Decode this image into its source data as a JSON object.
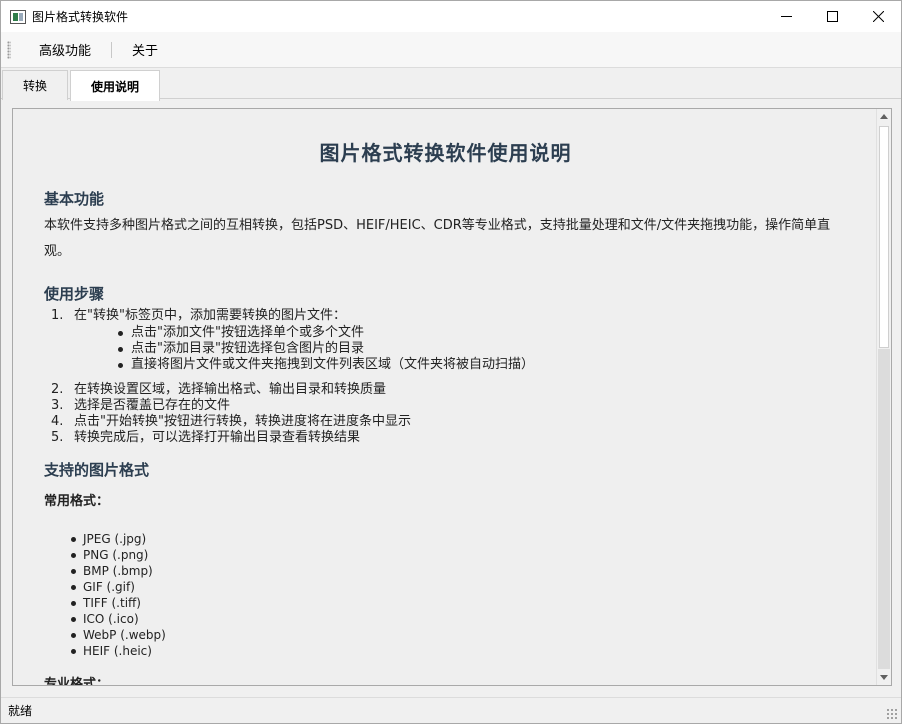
{
  "window": {
    "title": "图片格式转换软件",
    "icon": "image-converter-icon"
  },
  "menu": {
    "items": [
      "高级功能",
      "关于"
    ]
  },
  "tabs": [
    {
      "label": "转换",
      "active": false
    },
    {
      "label": "使用说明",
      "active": true
    }
  ],
  "doc": {
    "title": "图片格式转换软件使用说明",
    "basic_heading": "基本功能",
    "basic_text": "本软件支持多种图片格式之间的互相转换，包括PSD、HEIF/HEIC、CDR等专业格式，支持批量处理和文件/文件夹拖拽功能，操作简单直观。",
    "steps_heading": "使用步骤",
    "steps": [
      {
        "num": "1.",
        "text": "在\"转换\"标签页中，添加需要转换的图片文件："
      },
      {
        "num": "2.",
        "text": "在转换设置区域，选择输出格式、输出目录和转换质量"
      },
      {
        "num": "3.",
        "text": "选择是否覆盖已存在的文件"
      },
      {
        "num": "4.",
        "text": "点击\"开始转换\"按钮进行转换，转换进度将在进度条中显示"
      },
      {
        "num": "5.",
        "text": "转换完成后，可以选择打开输出目录查看转换结果"
      }
    ],
    "step1_sub": [
      "点击\"添加文件\"按钮选择单个或多个文件",
      "点击\"添加目录\"按钮选择包含图片的目录",
      "直接将图片文件或文件夹拖拽到文件列表区域（文件夹将被自动扫描）"
    ],
    "formats_heading": "支持的图片格式",
    "common_heading": "常用格式：",
    "common_formats": [
      "JPEG (.jpg)",
      "PNG (.png)",
      "BMP (.bmp)",
      "GIF (.gif)",
      "TIFF (.tiff)",
      "ICO (.ico)",
      "WebP (.webp)",
      "HEIF (.heic)"
    ],
    "pro_heading": "专业格式："
  },
  "status": {
    "text": "就绪"
  },
  "colors": {
    "heading": "#2c3e50",
    "content_bg": "#efefef"
  }
}
